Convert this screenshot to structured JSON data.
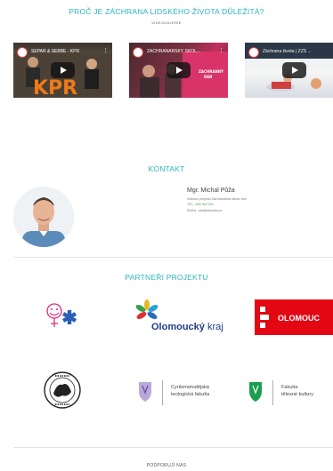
{
  "videos_section": {
    "title": "PROČ JE ZÁCHRANA LIDSKÉHO ŽIVOTA DŮLEŽITÁ?",
    "subtitle": "VIDEOGALERIE",
    "videos": [
      {
        "title": "SEPAR & SEBBE - KPR",
        "overlay_text": "KPR"
      },
      {
        "title": "ZÁCHRANÁŘSKÝ ŠKOL...",
        "overlay_text": "ZACHRANNÝ DEN"
      },
      {
        "title": "Záchrana života | ZZS ..."
      }
    ]
  },
  "contact": {
    "title": "KONTAKT",
    "name": "Mgr. Michal Půža",
    "role": "Vedoucí projektu Záchranářské školní den",
    "phone_label": "TEL.:",
    "phone": "608 962 004",
    "email_label": "EMAIL:",
    "email": "zsd@atomika.cz"
  },
  "partners": {
    "title": "PARTNEŘI PROJEKTU",
    "olomoucky_word": "Olomoucký",
    "kraj_word": "kraj",
    "olomouc": "OLOMOUC",
    "cmtf": [
      "Cyrilometodějská",
      "teologická fakulta"
    ],
    "ftk": [
      "Fakulta",
      "tělesné kultury"
    ]
  },
  "footer": {
    "text": "PODPORUJÍ NÁS"
  },
  "colors": {
    "accent": "#2bb5c0",
    "olomouc_red": "#e30613",
    "upol_green": "#1a9e50"
  }
}
